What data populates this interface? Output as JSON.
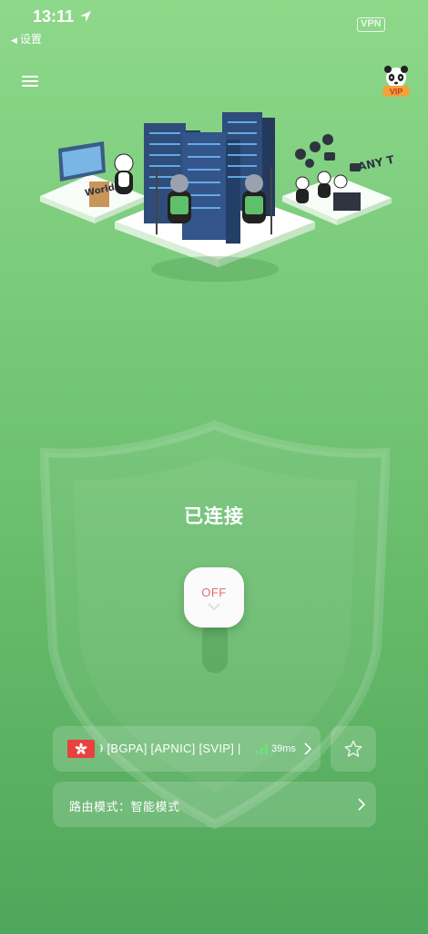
{
  "status_bar": {
    "time": "13:11",
    "back_label": "设置",
    "vpn_badge": "VPN"
  },
  "icons": {
    "menu": "hamburger-menu-icon",
    "vip": "panda-vip-icon",
    "location": "location-arrow-icon",
    "favorite": "star-icon",
    "chevron": "chevron-right-icon",
    "signal": "signal-bars-icon"
  },
  "connection": {
    "status_text": "已连接",
    "switch_label": "OFF"
  },
  "server": {
    "flag": "hong-kong-flag",
    "name": "9 [BGPA] [APNIC] [SVIP] |",
    "latency": "39ms"
  },
  "routing": {
    "label": "路由模式：智能模式"
  },
  "vip_badge": "VIP",
  "colors": {
    "background_top": "#8ed88a",
    "background_bottom": "#4fa75b",
    "off_text": "#e0706a",
    "signal": "#6fe07a"
  }
}
